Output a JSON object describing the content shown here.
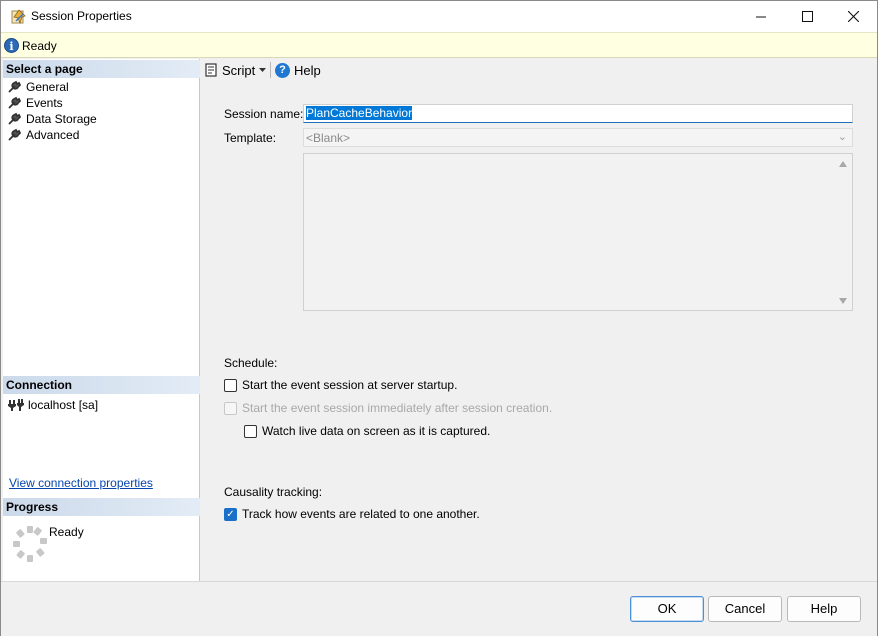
{
  "window": {
    "title": "Session Properties"
  },
  "status": {
    "text": "Ready"
  },
  "left": {
    "select_page_header": "Select a page",
    "pages": [
      {
        "label": "General"
      },
      {
        "label": "Events"
      },
      {
        "label": "Data Storage"
      },
      {
        "label": "Advanced"
      }
    ],
    "connection_header": "Connection",
    "connection": "localhost [sa]",
    "view_connection_link": "View connection properties",
    "progress_header": "Progress",
    "progress_status": "Ready"
  },
  "toolbar": {
    "script_label": "Script",
    "help_label": "Help"
  },
  "form": {
    "session_name_label": "Session name:",
    "session_name_value": "PlanCacheBehavior",
    "template_label": "Template:",
    "template_value": "<Blank>",
    "schedule_label": "Schedule:",
    "start_at_startup": "Start the event session at server startup.",
    "start_immediately": "Start the event session immediately after session creation.",
    "watch_live": "Watch live data on screen as it is captured.",
    "causality_label": "Causality tracking:",
    "track_events": "Track how events are related to one another."
  },
  "buttons": {
    "ok": "OK",
    "cancel": "Cancel",
    "help": "Help"
  },
  "colors": {
    "accent": "#0078d7",
    "status_bg": "#ffffe1",
    "header_bg": "#cbd9ea",
    "link": "#0645ad"
  }
}
